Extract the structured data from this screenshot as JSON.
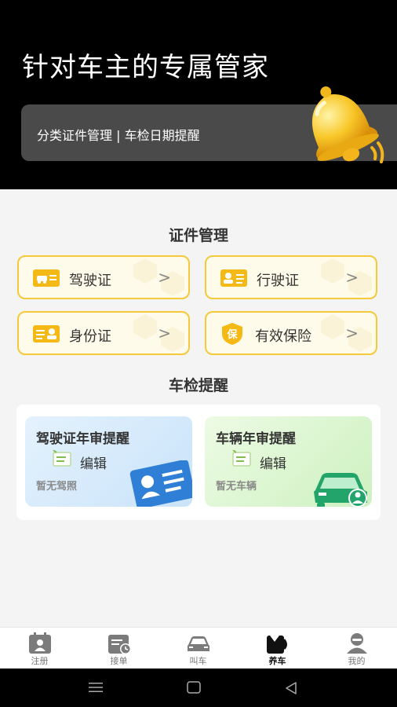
{
  "hero": {
    "title": "针对车主的专属管家",
    "subtitle": "分类证件管理 | 车检日期提醒"
  },
  "documents": {
    "section_title": "证件管理",
    "items": [
      {
        "label": "驾驶证",
        "icon": "driver-license-icon"
      },
      {
        "label": "行驶证",
        "icon": "vehicle-license-icon"
      },
      {
        "label": "身份证",
        "icon": "id-card-icon"
      },
      {
        "label": "有效保险",
        "icon": "insurance-shield-icon"
      }
    ],
    "chevron": ">"
  },
  "reminders": {
    "section_title": "车检提醒",
    "license_card": {
      "title": "驾驶证年审提醒",
      "edit": "编辑",
      "empty": "暂无驾照"
    },
    "vehicle_card": {
      "title": "车辆年审提醒",
      "edit": "编辑",
      "empty": "暂无车辆"
    }
  },
  "tabbar": {
    "tabs": [
      {
        "label": "注册",
        "icon": "register-icon",
        "active": false
      },
      {
        "label": "接单",
        "icon": "order-icon",
        "active": false
      },
      {
        "label": "叫车",
        "icon": "car-icon",
        "active": false
      },
      {
        "label": "养车",
        "icon": "maintenance-icon",
        "active": true
      },
      {
        "label": "我的",
        "icon": "profile-icon",
        "active": false
      }
    ]
  },
  "colors": {
    "accent_yellow": "#f5c93a",
    "license_card_bg": "#d9ecfb",
    "vehicle_card_bg": "#e2f7d8",
    "vehicle_green": "#22a46a",
    "license_blue": "#2f7fd6"
  }
}
